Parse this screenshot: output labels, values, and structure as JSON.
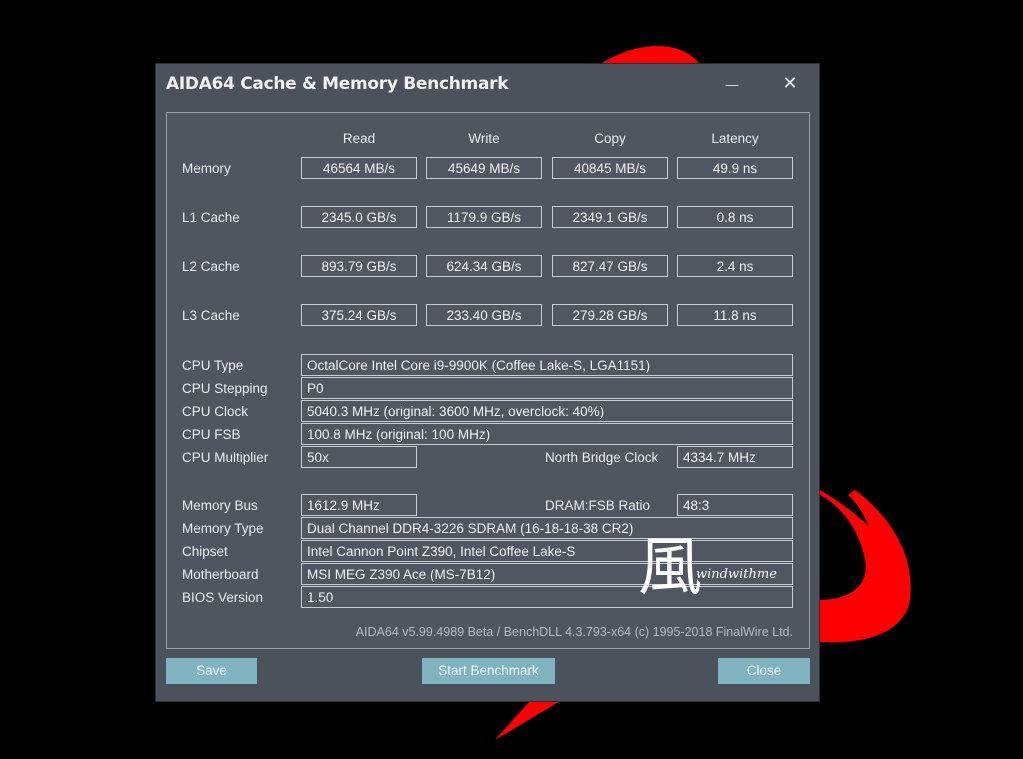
{
  "window": {
    "title": "AIDA64 Cache & Memory Benchmark",
    "minimize_glyph": "—",
    "close_glyph": "✕"
  },
  "columns": [
    "Read",
    "Write",
    "Copy",
    "Latency"
  ],
  "bench_rows": [
    {
      "label": "Memory",
      "read": "46564 MB/s",
      "write": "45649 MB/s",
      "copy": "40845 MB/s",
      "latency": "49.9 ns"
    },
    {
      "label": "L1 Cache",
      "read": "2345.0 GB/s",
      "write": "1179.9 GB/s",
      "copy": "2349.1 GB/s",
      "latency": "0.8 ns"
    },
    {
      "label": "L2 Cache",
      "read": "893.79 GB/s",
      "write": "624.34 GB/s",
      "copy": "827.47 GB/s",
      "latency": "2.4 ns"
    },
    {
      "label": "L3 Cache",
      "read": "375.24 GB/s",
      "write": "233.40 GB/s",
      "copy": "279.28 GB/s",
      "latency": "11.8 ns"
    }
  ],
  "cpu": {
    "type_label": "CPU Type",
    "type": "OctalCore Intel Core i9-9900K  (Coffee Lake-S, LGA1151)",
    "stepping_label": "CPU Stepping",
    "stepping": "P0",
    "clock_label": "CPU Clock",
    "clock": "5040.3 MHz  (original: 3600 MHz, overclock: 40%)",
    "fsb_label": "CPU FSB",
    "fsb": "100.8 MHz  (original: 100 MHz)",
    "multiplier_label": "CPU Multiplier",
    "multiplier": "50x",
    "nb_clock_label": "North Bridge Clock",
    "nb_clock": "4334.7 MHz"
  },
  "memory": {
    "bus_label": "Memory Bus",
    "bus": "1612.9 MHz",
    "ratio_label": "DRAM:FSB Ratio",
    "ratio": "48:3",
    "type_label": "Memory Type",
    "type": "Dual Channel DDR4-3226 SDRAM  (16-18-18-38 CR2)",
    "chipset_label": "Chipset",
    "chipset": "Intel Cannon Point Z390, Intel Coffee Lake-S",
    "motherboard_label": "Motherboard",
    "motherboard": "MSI MEG Z390 Ace (MS-7B12)",
    "bios_label": "BIOS Version",
    "bios": "1.50"
  },
  "footer": "AIDA64 v5.99.4989 Beta / BenchDLL 4.3.793-x64  (c) 1995-2018 FinalWire Ltd.",
  "buttons": {
    "save": "Save",
    "start": "Start Benchmark",
    "close": "Close"
  },
  "watermark": {
    "glyph": "風",
    "text": "windwithme"
  },
  "colors": {
    "accent_button": "#7fb3c0",
    "window_bg": "#4b525b",
    "bg_red": "#ff0000"
  }
}
